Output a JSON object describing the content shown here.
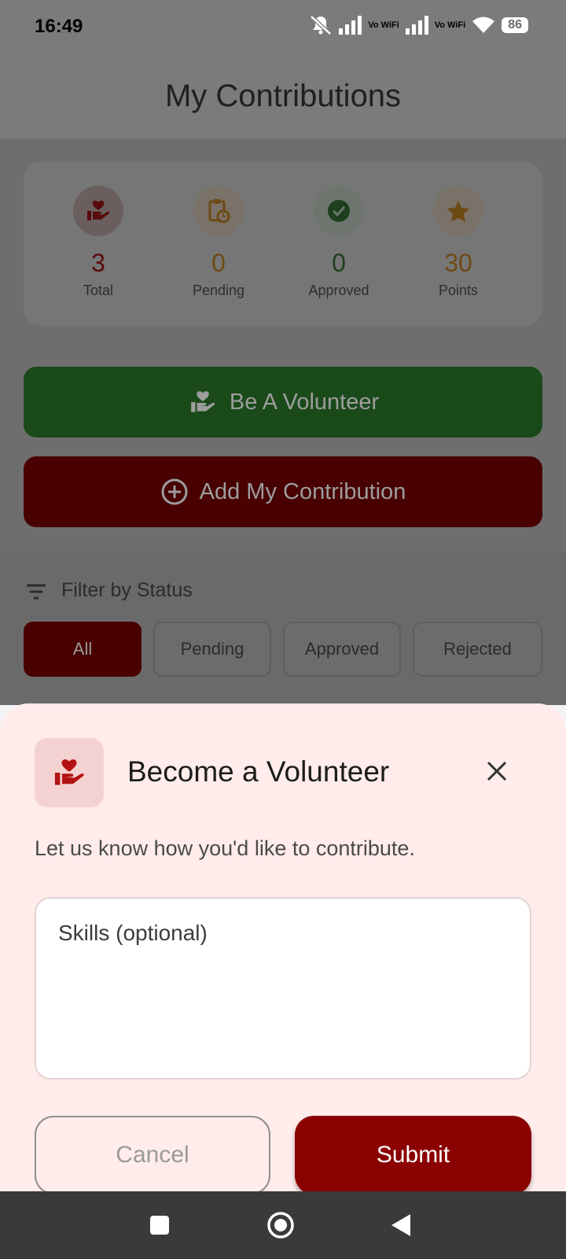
{
  "status_bar": {
    "time": "16:49",
    "vowifi_1": "Vo WiFi",
    "vowifi_2": "Vo WiFi",
    "battery": "86"
  },
  "header": {
    "title": "My Contributions"
  },
  "stats": [
    {
      "value": "3",
      "label": "Total",
      "color": "#8b0000",
      "icon": "heart-hand-icon"
    },
    {
      "value": "0",
      "label": "Pending",
      "color": "#b5731a",
      "icon": "clipboard-clock-icon"
    },
    {
      "value": "0",
      "label": "Approved",
      "color": "#2e6b2e",
      "icon": "check-circle-icon"
    },
    {
      "value": "30",
      "label": "Points",
      "color": "#b5731a",
      "icon": "star-icon"
    }
  ],
  "actions": {
    "volunteer_label": "Be A Volunteer",
    "add_label": "Add My Contribution"
  },
  "filter": {
    "label": "Filter by Status",
    "chips": [
      "All",
      "Pending",
      "Approved",
      "Rejected"
    ],
    "active": "All"
  },
  "sheet": {
    "title": "Become a Volunteer",
    "subtitle": "Let us know how you'd like to contribute.",
    "skills_placeholder": "Skills (optional)",
    "cancel_label": "Cancel",
    "submit_label": "Submit"
  },
  "colors": {
    "primary": "#8b0000",
    "green": "#1a4a1a",
    "sheet_bg": "#ffeceb"
  }
}
